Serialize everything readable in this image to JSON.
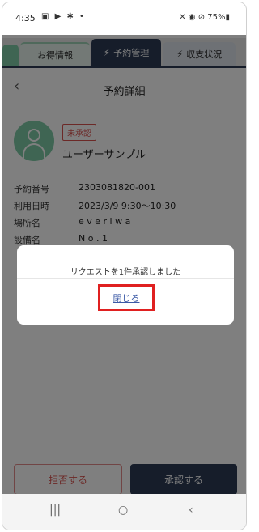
{
  "status_bar": {
    "time": "4:35",
    "left_icons": "▣ ▶ ✱ •",
    "right_icons": "✕ ◉ ⊘ 75%▮"
  },
  "tabs": [
    {
      "label": "お得情報",
      "icon": ""
    },
    {
      "label": "予約管理",
      "icon": "⚡"
    },
    {
      "label": "収支状況",
      "icon": "⚡"
    }
  ],
  "header": {
    "back_icon": "‹",
    "title": "予約詳細"
  },
  "user": {
    "status_badge": "未承認",
    "name": "ユーザーサンプル"
  },
  "details": [
    {
      "label": "予約番号",
      "value": "2303081820-001"
    },
    {
      "label": "利用日時",
      "value": "2023/3/9 9:30〜10:30"
    },
    {
      "label": "場所名",
      "value": "e v e r i w a"
    },
    {
      "label": "設備名",
      "value": "N o . 1"
    }
  ],
  "actions": {
    "reject": "拒否する",
    "approve": "承認する"
  },
  "dialog": {
    "message": "リクエストを1件承認しました",
    "close": "閉じる"
  },
  "nav": {
    "recent": "|||",
    "home": "○",
    "back": "‹"
  },
  "colors": {
    "primary": "#2c3b55",
    "accent_green": "#7fcaa6",
    "danger": "#d9534f",
    "highlight_box": "#e02020"
  }
}
